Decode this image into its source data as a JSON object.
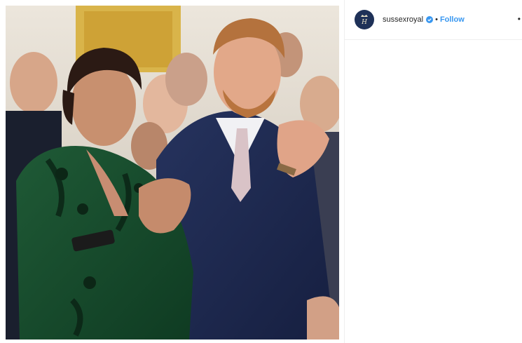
{
  "post": {
    "username": "sussexroyal",
    "separator": "•",
    "follow_label": "Follow",
    "more_label": "•",
    "verified": true,
    "avatar_icon": "royal-cypher-icon",
    "photo_icon": "couple-clapping-photo"
  },
  "colors": {
    "follow": "#3897f0",
    "verified_badge": "#3897f0",
    "avatar_bg": "#1e3158",
    "divider": "#efefef"
  }
}
